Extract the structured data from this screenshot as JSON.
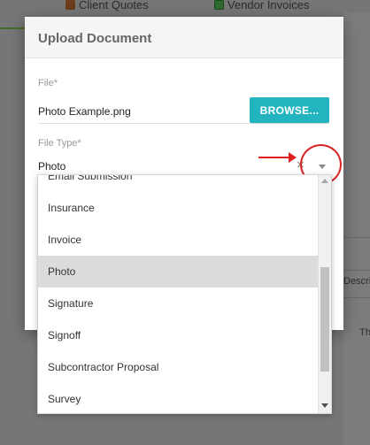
{
  "background": {
    "tabs": [
      {
        "label": "Client Quotes",
        "icon": "clipboard-icon"
      },
      {
        "label": "Vendor Invoices",
        "icon": "money-icon"
      }
    ],
    "column_header_partial": "Descri",
    "cell_partial": "Th"
  },
  "modal": {
    "title": "Upload Document",
    "file": {
      "label": "File*",
      "value": "Photo Example.png",
      "button_label": "BROWSE..."
    },
    "file_type": {
      "label": "File Type*",
      "value": "Photo",
      "clear_glyph": "×"
    }
  },
  "dropdown": {
    "options": [
      "Email Submission",
      "Insurance",
      "Invoice",
      "Photo",
      "Signature",
      "Signoff",
      "Subcontractor Proposal",
      "Survey"
    ],
    "selected": "Photo"
  },
  "colors": {
    "accent_button": "#22b5c0",
    "annotation_red": "#e02020"
  }
}
